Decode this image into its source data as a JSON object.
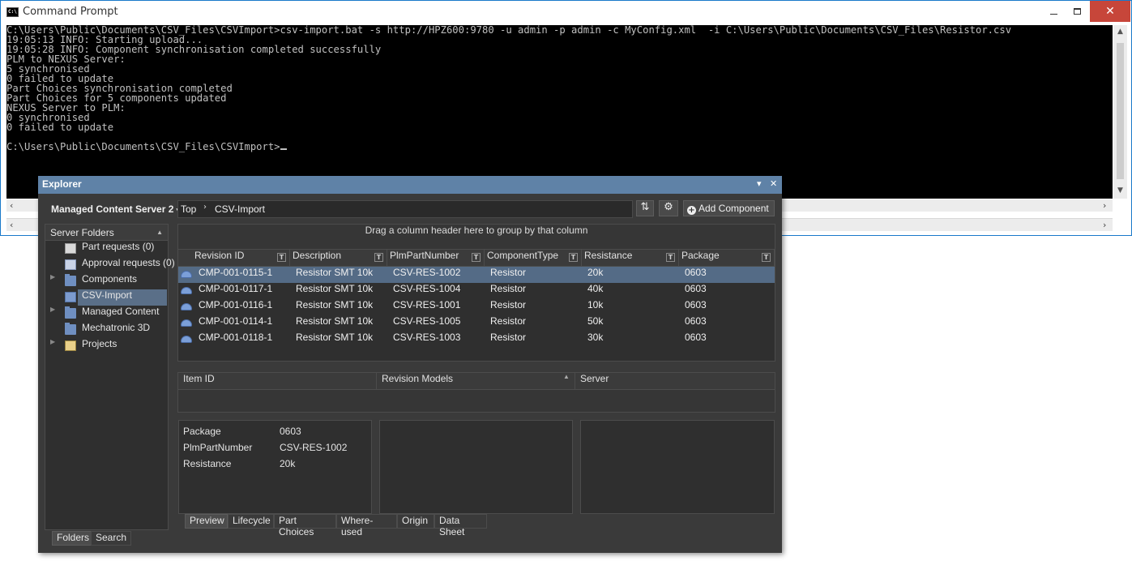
{
  "cmd": {
    "title": "Command Prompt",
    "icon_label": "C:\\.",
    "lines": [
      "C:\\Users\\Public\\Documents\\CSV_Files\\CSVImport>csv-import.bat -s http://HPZ600:9780 -u admin -p admin -c MyConfig.xml  -i C:\\Users\\Public\\Documents\\CSV_Files\\Resistor.csv",
      "19:05:13 INFO: Starting upload...",
      "19:05:28 INFO: Component synchronisation completed successfully",
      "PLM to NEXUS Server:",
      "5 synchronised",
      "0 failed to update",
      "Part Choices synchronisation completed",
      "Part Choices for 5 components updated",
      "NEXUS Server to PLM:",
      "0 synchronised",
      "0 failed to update",
      "",
      "C:\\Users\\Public\\Documents\\CSV_Files\\CSVImport>"
    ],
    "close_glyph": "✕"
  },
  "explorer": {
    "title": "Explorer",
    "pin_glyph": "▾",
    "close_glyph": "✕",
    "server": "Managed Content Server 2",
    "dropdown_glyph": "▾",
    "breadcrumb": [
      "Top",
      "CSV-Import"
    ],
    "breadcrumb_sep": "›",
    "refresh_glyph": "⇅",
    "settings_glyph": "⚙",
    "add_component": "Add Component",
    "add_glyph": "+",
    "folders_header": "Server Folders",
    "folders": [
      {
        "label": "Part requests (0)",
        "icon": "part-request-icon",
        "expandable": false
      },
      {
        "label": "Approval requests (0)",
        "icon": "approval-request-icon",
        "expandable": false
      },
      {
        "label": "Components",
        "icon": "folder-icon",
        "expandable": true
      },
      {
        "label": "CSV-Import",
        "icon": "component-folder-icon",
        "expandable": false,
        "selected": true
      },
      {
        "label": "Managed Content",
        "icon": "folder-icon",
        "expandable": true
      },
      {
        "label": "Mechatronic 3D",
        "icon": "folder-icon",
        "expandable": false
      },
      {
        "label": "Projects",
        "icon": "projects-icon",
        "expandable": true
      }
    ],
    "left_tabs": [
      "Folders",
      "Search"
    ],
    "group_hint": "Drag a column header here to group by that column",
    "filter_glyph": "T",
    "columns": [
      "Revision ID",
      "Description",
      "PlmPartNumber",
      "ComponentType",
      "Resistance",
      "Package"
    ],
    "rows": [
      [
        "CMP-001-0115-1",
        "Resistor SMT 10k",
        "CSV-RES-1002",
        "Resistor",
        "20k",
        "0603"
      ],
      [
        "CMP-001-0117-1",
        "Resistor SMT 10k",
        "CSV-RES-1004",
        "Resistor",
        "40k",
        "0603"
      ],
      [
        "CMP-001-0116-1",
        "Resistor SMT 10k",
        "CSV-RES-1001",
        "Resistor",
        "10k",
        "0603"
      ],
      [
        "CMP-001-0114-1",
        "Resistor SMT 10k",
        "CSV-RES-1005",
        "Resistor",
        "50k",
        "0603"
      ],
      [
        "CMP-001-0118-1",
        "Resistor SMT 10k",
        "CSV-RES-1003",
        "Resistor",
        "30k",
        "0603"
      ]
    ],
    "item_columns": [
      "Item ID",
      "Revision Models",
      "Server"
    ],
    "sort_glyph": "▲",
    "properties": [
      {
        "name": "Package",
        "value": "0603"
      },
      {
        "name": "PlmPartNumber",
        "value": "CSV-RES-1002"
      },
      {
        "name": "Resistance",
        "value": "20k"
      }
    ],
    "detail_tabs": [
      "Preview",
      "Lifecycle",
      "Part Choices",
      "Where-used",
      "Origin",
      "Data Sheet"
    ]
  }
}
